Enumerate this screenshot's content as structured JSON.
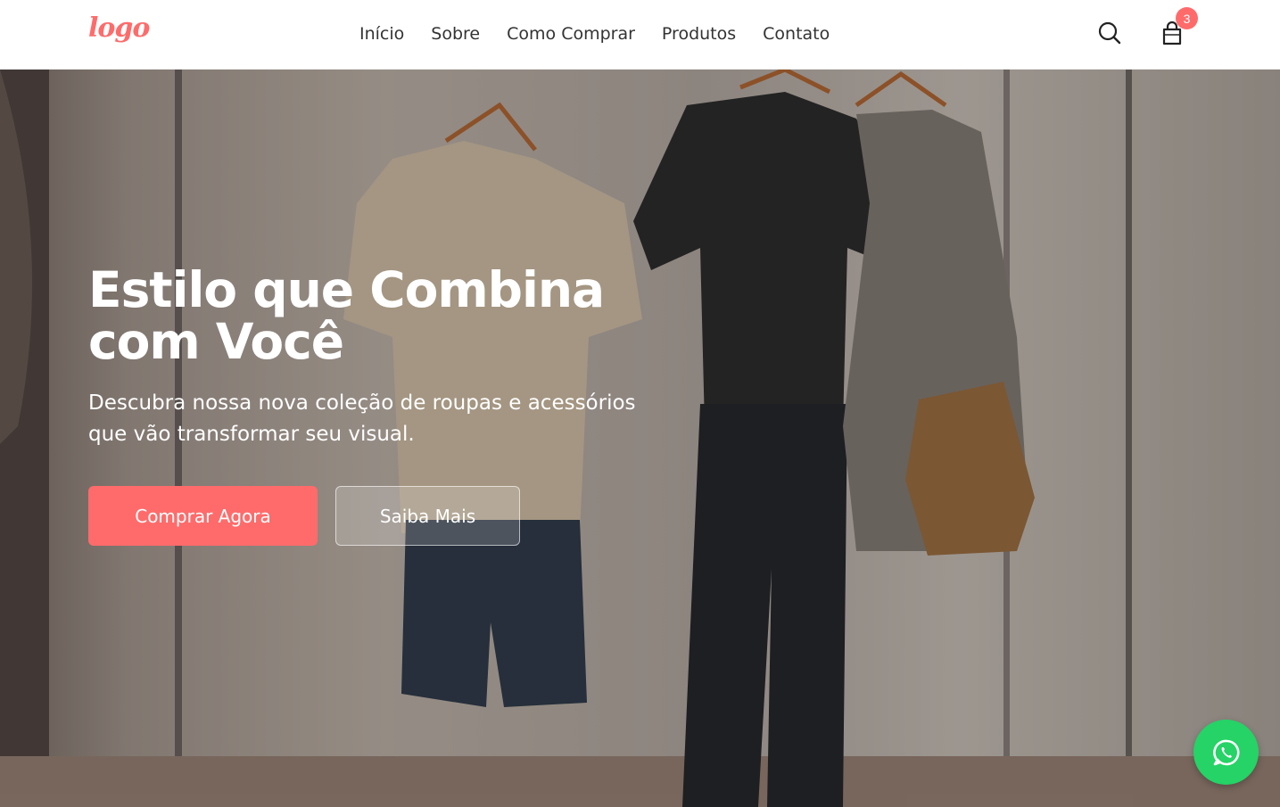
{
  "header": {
    "logo_text": "logo",
    "nav": [
      "Início",
      "Sobre",
      "Como Comprar",
      "Produtos",
      "Contato"
    ],
    "cart_count": "3",
    "icons": [
      "search-icon",
      "shopping-bag-icon"
    ]
  },
  "hero": {
    "title_line1": "Estilo que Combina",
    "title_line2": "com Você",
    "subtitle_line1": "Descubra nossa nova coleção de roupas e acessórios",
    "subtitle_line2": "que vão transformar seu visual.",
    "primary_button": "Comprar Agora",
    "secondary_button": "Saiba Mais"
  },
  "floating": {
    "whatsapp_icon": "whatsapp-icon"
  },
  "colors": {
    "accent": "#ff6b6b",
    "whatsapp": "#25d366",
    "nav_text": "#333333"
  }
}
